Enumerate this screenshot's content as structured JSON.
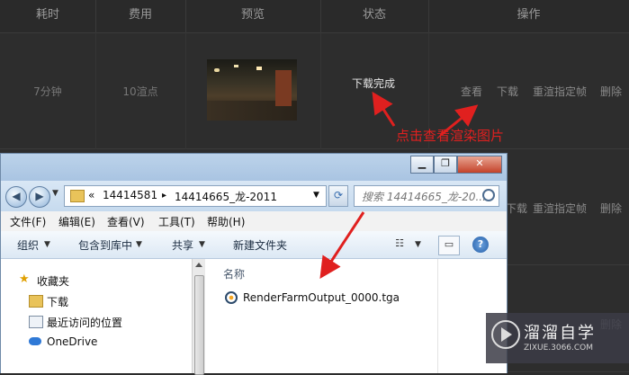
{
  "table": {
    "headers": [
      "耗时",
      "费用",
      "预览",
      "状态",
      "操作"
    ],
    "row1": {
      "duration": "7分钟",
      "cost": "10渲点",
      "status": "下载完成",
      "actions": [
        "查看",
        "下载",
        "重渲指定帧",
        "删除"
      ]
    },
    "row2": {
      "actions": [
        "下载",
        "重渲指定帧",
        "删除"
      ]
    },
    "row3": {
      "actions": [
        "删除"
      ]
    }
  },
  "annotation": "点击查看渲染图片",
  "explorer": {
    "title_buttons": {
      "minimize": "▁",
      "maximize": "❐",
      "close": "✕"
    },
    "address": {
      "prefix": "«",
      "segment1": "14414581",
      "separator": "▸",
      "segment2": "14414665_龙-2011"
    },
    "search_placeholder": "搜索 14414665_龙-20...",
    "menu": [
      "文件(F)",
      "编辑(E)",
      "查看(V)",
      "工具(T)",
      "帮助(H)"
    ],
    "toolbar": [
      "组织",
      "包含到库中",
      "共享",
      "新建文件夹"
    ],
    "nav_items": [
      "收藏夹",
      "下载",
      "最近访问的位置",
      "OneDrive"
    ],
    "column_name": "名称",
    "file_name": "RenderFarmOutput_0000.tga"
  },
  "watermark": {
    "title": "溜溜自学",
    "url": "ZIXUE.3066.COM"
  },
  "colors": {
    "annotation_red": "#e0201f",
    "background": "#2d2d2d"
  },
  "icons": [
    "back-arrow-icon",
    "forward-arrow-icon",
    "refresh-icon",
    "search-icon",
    "star-icon",
    "folder-icon",
    "onedrive-icon",
    "help-icon",
    "view-icon",
    "pane-icon",
    "file-icon"
  ]
}
